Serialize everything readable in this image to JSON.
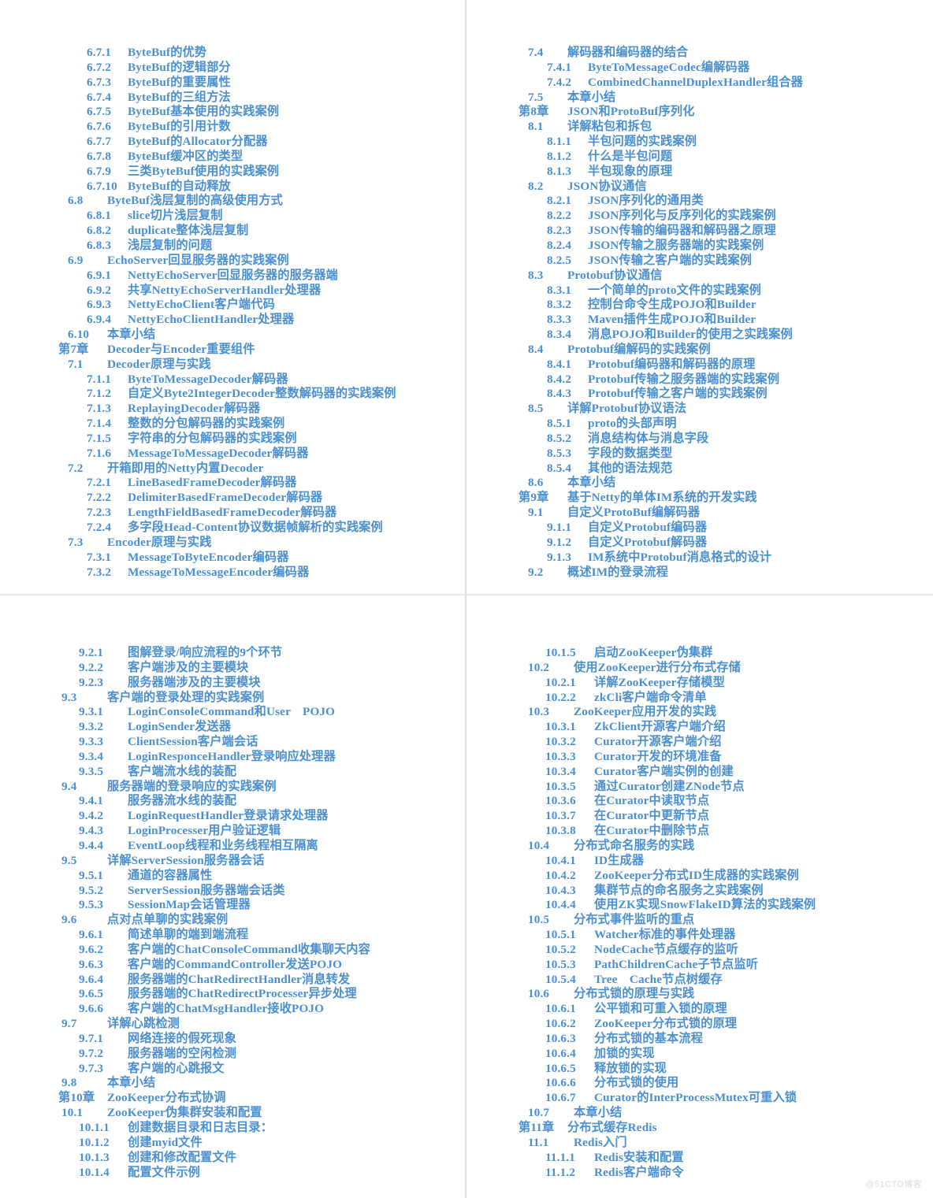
{
  "document": {
    "kind": "book-table-of-contents",
    "watermark": "@51CTO博客"
  },
  "pages": [
    {
      "id": "page-top-left",
      "entries": [
        {
          "level": 3,
          "num": "6.7.1",
          "title": "ByteBuf的优势"
        },
        {
          "level": 3,
          "num": "6.7.2",
          "title": "ByteBuf的逻辑部分"
        },
        {
          "level": 3,
          "num": "6.7.3",
          "title": "ByteBuf的重要属性"
        },
        {
          "level": 3,
          "num": "6.7.4",
          "title": "ByteBuf的三组方法"
        },
        {
          "level": 3,
          "num": "6.7.5",
          "title": "ByteBuf基本使用的实践案例"
        },
        {
          "level": 3,
          "num": "6.7.6",
          "title": "ByteBuf的引用计数"
        },
        {
          "level": 3,
          "num": "6.7.7",
          "title": "ByteBuf的Allocator分配器"
        },
        {
          "level": 3,
          "num": "6.7.8",
          "title": "ByteBuf缓冲区的类型"
        },
        {
          "level": 3,
          "num": "6.7.9",
          "title": "三类ByteBuf使用的实践案例"
        },
        {
          "level": 3,
          "num": "6.7.10",
          "title": "ByteBuf的自动释放"
        },
        {
          "level": 2,
          "num": "6.8",
          "title": "ByteBuf浅层复制的高级使用方式"
        },
        {
          "level": 3,
          "num": "6.8.1",
          "title": "slice切片浅层复制"
        },
        {
          "level": 3,
          "num": "6.8.2",
          "title": "duplicate整体浅层复制"
        },
        {
          "level": 3,
          "num": "6.8.3",
          "title": "浅层复制的问题"
        },
        {
          "level": 2,
          "num": "6.9",
          "title": "EchoServer回显服务器的实践案例"
        },
        {
          "level": 3,
          "num": "6.9.1",
          "title": "NettyEchoServer回显服务器的服务器端"
        },
        {
          "level": 3,
          "num": "6.9.2",
          "title": "共享NettyEchoServerHandler处理器"
        },
        {
          "level": 3,
          "num": "6.9.3",
          "title": "NettyEchoClient客户端代码"
        },
        {
          "level": 3,
          "num": "6.9.4",
          "title": "NettyEchoClientHandler处理器"
        },
        {
          "level": 2,
          "num": "6.10",
          "title": "本章小结"
        },
        {
          "level": 1,
          "num": "第7章",
          "title": "Decoder与Encoder重要组件"
        },
        {
          "level": 2,
          "num": "7.1",
          "title": "Decoder原理与实践"
        },
        {
          "level": 3,
          "num": "7.1.1",
          "title": "ByteToMessageDecoder解码器"
        },
        {
          "level": 3,
          "num": "7.1.2",
          "title": "自定义Byte2IntegerDecoder整数解码器的实践案例"
        },
        {
          "level": 3,
          "num": "7.1.3",
          "title": "ReplayingDecoder解码器"
        },
        {
          "level": 3,
          "num": "7.1.4",
          "title": "整数的分包解码器的实践案例"
        },
        {
          "level": 3,
          "num": "7.1.5",
          "title": "字符串的分包解码器的实践案例"
        },
        {
          "level": 3,
          "num": "7.1.6",
          "title": "MessageToMessageDecoder解码器"
        },
        {
          "level": 2,
          "num": "7.2",
          "title": "开箱即用的Netty内置Decoder"
        },
        {
          "level": 3,
          "num": "7.2.1",
          "title": "LineBasedFrameDecoder解码器"
        },
        {
          "level": 3,
          "num": "7.2.2",
          "title": "DelimiterBasedFrameDecoder解码器"
        },
        {
          "level": 3,
          "num": "7.2.3",
          "title": "LengthFieldBasedFrameDecoder解码器"
        },
        {
          "level": 3,
          "num": "7.2.4",
          "title": "多字段Head-Content协议数据帧解析的实践案例"
        },
        {
          "level": 2,
          "num": "7.3",
          "title": "Encoder原理与实践"
        },
        {
          "level": 3,
          "num": "7.3.1",
          "title": "MessageToByteEncoder编码器"
        },
        {
          "level": 3,
          "num": "7.3.2",
          "title": "MessageToMessageEncoder编码器"
        }
      ]
    },
    {
      "id": "page-top-right",
      "entries": [
        {
          "level": 2,
          "num": "7.4",
          "title": "解码器和编码器的结合"
        },
        {
          "level": 3,
          "num": "7.4.1",
          "title": "ByteToMessageCodec编解码器"
        },
        {
          "level": 3,
          "num": "7.4.2",
          "title": "CombinedChannelDuplexHandler组合器"
        },
        {
          "level": 2,
          "num": "7.5",
          "title": "本章小结"
        },
        {
          "level": 1,
          "num": "第8章",
          "title": "JSON和ProtoBuf序列化"
        },
        {
          "level": 2,
          "num": "8.1",
          "title": "详解粘包和拆包"
        },
        {
          "level": 3,
          "num": "8.1.1",
          "title": "半包问题的实践案例"
        },
        {
          "level": 3,
          "num": "8.1.2",
          "title": "什么是半包问题"
        },
        {
          "level": 3,
          "num": "8.1.3",
          "title": "半包现象的原理"
        },
        {
          "level": 2,
          "num": "8.2",
          "title": "JSON协议通信"
        },
        {
          "level": 3,
          "num": "8.2.1",
          "title": "JSON序列化的通用类"
        },
        {
          "level": 3,
          "num": "8.2.2",
          "title": "JSON序列化与反序列化的实践案例"
        },
        {
          "level": 3,
          "num": "8.2.3",
          "title": "JSON传输的编码器和解码器之原理"
        },
        {
          "level": 3,
          "num": "8.2.4",
          "title": "JSON传输之服务器端的实践案例"
        },
        {
          "level": 3,
          "num": "8.2.5",
          "title": "JSON传输之客户端的实践案例"
        },
        {
          "level": 2,
          "num": "8.3",
          "title": "Protobuf协议通信"
        },
        {
          "level": 3,
          "num": "8.3.1",
          "title": "一个简单的proto文件的实践案例"
        },
        {
          "level": 3,
          "num": "8.3.2",
          "title": "控制台命令生成POJO和Builder"
        },
        {
          "level": 3,
          "num": "8.3.3",
          "title": "Maven插件生成POJO和Builder"
        },
        {
          "level": 3,
          "num": "8.3.4",
          "title": "消息POJO和Builder的使用之实践案例"
        },
        {
          "level": 2,
          "num": "8.4",
          "title": "Protobuf编解码的实践案例"
        },
        {
          "level": 3,
          "num": "8.4.1",
          "title": "Protobuf编码器和解码器的原理"
        },
        {
          "level": 3,
          "num": "8.4.2",
          "title": "Protobuf传输之服务器端的实践案例"
        },
        {
          "level": 3,
          "num": "8.4.3",
          "title": "Protobuf传输之客户端的实践案例"
        },
        {
          "level": 2,
          "num": "8.5",
          "title": "详解Protobuf协议语法"
        },
        {
          "level": 3,
          "num": "8.5.1",
          "title": "proto的头部声明"
        },
        {
          "level": 3,
          "num": "8.5.2",
          "title": "消息结构体与消息字段"
        },
        {
          "level": 3,
          "num": "8.5.3",
          "title": "字段的数据类型"
        },
        {
          "level": 3,
          "num": "8.5.4",
          "title": "其他的语法规范"
        },
        {
          "level": 2,
          "num": "8.6",
          "title": "本章小结"
        },
        {
          "level": 1,
          "num": "第9章",
          "title": "基于Netty的单体IM系统的开发实践"
        },
        {
          "level": 2,
          "num": "9.1",
          "title": "自定义ProtoBuf编解码器"
        },
        {
          "level": 3,
          "num": "9.1.1",
          "title": "自定义Protobuf编码器"
        },
        {
          "level": 3,
          "num": "9.1.2",
          "title": "自定义Protobuf解码器"
        },
        {
          "level": 3,
          "num": "9.1.3",
          "title": "IM系统中Protobuf消息格式的设计"
        },
        {
          "level": 2,
          "num": "9.2",
          "title": "概述IM的登录流程"
        }
      ]
    },
    {
      "id": "page-bottom-left",
      "entries": [
        {
          "level": 3,
          "num": "9.2.1",
          "title": "图解登录/响应流程的9个环节"
        },
        {
          "level": 3,
          "num": "9.2.2",
          "title": "客户端涉及的主要模块"
        },
        {
          "level": 3,
          "num": "9.2.3",
          "title": "服务器端涉及的主要模块"
        },
        {
          "level": 2,
          "num": "9.3",
          "title": "客户端的登录处理的实践案例"
        },
        {
          "level": 3,
          "num": "9.3.1",
          "title": "LoginConsoleCommand和User　POJO"
        },
        {
          "level": 3,
          "num": "9.3.2",
          "title": "LoginSender发送器"
        },
        {
          "level": 3,
          "num": "9.3.3",
          "title": "ClientSession客户端会话"
        },
        {
          "level": 3,
          "num": "9.3.4",
          "title": "LoginResponceHandler登录响应处理器"
        },
        {
          "level": 3,
          "num": "9.3.5",
          "title": "客户端流水线的装配"
        },
        {
          "level": 2,
          "num": "9.4",
          "title": "服务器端的登录响应的实践案例"
        },
        {
          "level": 3,
          "num": "9.4.1",
          "title": "服务器流水线的装配"
        },
        {
          "level": 3,
          "num": "9.4.2",
          "title": "LoginRequestHandler登录请求处理器"
        },
        {
          "level": 3,
          "num": "9.4.3",
          "title": "LoginProcesser用户验证逻辑"
        },
        {
          "level": 3,
          "num": "9.4.4",
          "title": "EventLoop线程和业务线程相互隔离"
        },
        {
          "level": 2,
          "num": "9.5",
          "title": "详解ServerSession服务器会话"
        },
        {
          "level": 3,
          "num": "9.5.1",
          "title": "通道的容器属性"
        },
        {
          "level": 3,
          "num": "9.5.2",
          "title": "ServerSession服务器端会话类"
        },
        {
          "level": 3,
          "num": "9.5.3",
          "title": "SessionMap会话管理器"
        },
        {
          "level": 2,
          "num": "9.6",
          "title": "点对点单聊的实践案例"
        },
        {
          "level": 3,
          "num": "9.6.1",
          "title": "简述单聊的端到端流程"
        },
        {
          "level": 3,
          "num": "9.6.2",
          "title": "客户端的ChatConsoleCommand收集聊天内容"
        },
        {
          "level": 3,
          "num": "9.6.3",
          "title": "客户端的CommandController发送POJO"
        },
        {
          "level": 3,
          "num": "9.6.4",
          "title": "服务器端的ChatRedirectHandler消息转发"
        },
        {
          "level": 3,
          "num": "9.6.5",
          "title": "服务器端的ChatRedirectProcesser异步处理"
        },
        {
          "level": 3,
          "num": "9.6.6",
          "title": "客户端的ChatMsgHandler接收POJO"
        },
        {
          "level": 2,
          "num": "9.7",
          "title": "详解心跳检测"
        },
        {
          "level": 3,
          "num": "9.7.1",
          "title": "网络连接的假死现象"
        },
        {
          "level": 3,
          "num": "9.7.2",
          "title": "服务器端的空闲检测"
        },
        {
          "level": 3,
          "num": "9.7.3",
          "title": "客户端的心跳报文"
        },
        {
          "level": 2,
          "num": "9.8",
          "title": "本章小结"
        },
        {
          "level": 1,
          "num": "第10章",
          "title": "ZooKeeper分布式协调"
        },
        {
          "level": 2,
          "num": "10.1",
          "title": "ZooKeeper伪集群安装和配置"
        },
        {
          "level": 3,
          "num": "10.1.1",
          "title": "创建数据目录和日志目录："
        },
        {
          "level": 3,
          "num": "10.1.2",
          "title": "创建myid文件"
        },
        {
          "level": 3,
          "num": "10.1.3",
          "title": "创建和修改配置文件"
        },
        {
          "level": 3,
          "num": "10.1.4",
          "title": "配置文件示例"
        }
      ]
    },
    {
      "id": "page-bottom-right",
      "entries": [
        {
          "level": 3,
          "num": "10.1.5",
          "title": "启动ZooKeeper伪集群"
        },
        {
          "level": 2,
          "num": "10.2",
          "title": "使用ZooKeeper进行分布式存储"
        },
        {
          "level": 3,
          "num": "10.2.1",
          "title": "详解ZooKeeper存储模型"
        },
        {
          "level": 3,
          "num": "10.2.2",
          "title": "zkCli客户端命令清单"
        },
        {
          "level": 2,
          "num": "10.3",
          "title": "ZooKeeper应用开发的实践"
        },
        {
          "level": 3,
          "num": "10.3.1",
          "title": "ZkClient开源客户端介绍"
        },
        {
          "level": 3,
          "num": "10.3.2",
          "title": "Curator开源客户端介绍"
        },
        {
          "level": 3,
          "num": "10.3.3",
          "title": "Curator开发的环境准备"
        },
        {
          "level": 3,
          "num": "10.3.4",
          "title": "Curator客户端实例的创建"
        },
        {
          "level": 3,
          "num": "10.3.5",
          "title": "通过Curator创建ZNode节点"
        },
        {
          "level": 3,
          "num": "10.3.6",
          "title": "在Curator中读取节点"
        },
        {
          "level": 3,
          "num": "10.3.7",
          "title": "在Curator中更新节点"
        },
        {
          "level": 3,
          "num": "10.3.8",
          "title": "在Curator中删除节点"
        },
        {
          "level": 2,
          "num": "10.4",
          "title": "分布式命名服务的实践"
        },
        {
          "level": 3,
          "num": "10.4.1",
          "title": "ID生成器"
        },
        {
          "level": 3,
          "num": "10.4.2",
          "title": "ZooKeeper分布式ID生成器的实践案例"
        },
        {
          "level": 3,
          "num": "10.4.3",
          "title": "集群节点的命名服务之实践案例"
        },
        {
          "level": 3,
          "num": "10.4.4",
          "title": "使用ZK实现SnowFlakeID算法的实践案例"
        },
        {
          "level": 2,
          "num": "10.5",
          "title": "分布式事件监听的重点"
        },
        {
          "level": 3,
          "num": "10.5.1",
          "title": "Watcher标准的事件处理器"
        },
        {
          "level": 3,
          "num": "10.5.2",
          "title": "NodeCache节点缓存的监听"
        },
        {
          "level": 3,
          "num": "10.5.3",
          "title": "PathChildrenCache子节点监听"
        },
        {
          "level": 3,
          "num": "10.5.4",
          "title": "Tree　Cache节点树缓存"
        },
        {
          "level": 2,
          "num": "10.6",
          "title": "分布式锁的原理与实践"
        },
        {
          "level": 3,
          "num": "10.6.1",
          "title": "公平锁和可重入锁的原理"
        },
        {
          "level": 3,
          "num": "10.6.2",
          "title": "ZooKeeper分布式锁的原理"
        },
        {
          "level": 3,
          "num": "10.6.3",
          "title": "分布式锁的基本流程"
        },
        {
          "level": 3,
          "num": "10.6.4",
          "title": "加锁的实现"
        },
        {
          "level": 3,
          "num": "10.6.5",
          "title": "释放锁的实现"
        },
        {
          "level": 3,
          "num": "10.6.6",
          "title": "分布式锁的使用"
        },
        {
          "level": 3,
          "num": "10.6.7",
          "title": "Curator的InterProcessMutex可重入锁"
        },
        {
          "level": 2,
          "num": "10.7",
          "title": "本章小结"
        },
        {
          "level": 1,
          "num": "第11章",
          "title": "分布式缓存Redis"
        },
        {
          "level": 2,
          "num": "11.1",
          "title": "Redis入门"
        },
        {
          "level": 3,
          "num": "11.1.1",
          "title": "Redis安装和配置"
        },
        {
          "level": 3,
          "num": "11.1.2",
          "title": "Redis客户端命令"
        }
      ]
    }
  ]
}
